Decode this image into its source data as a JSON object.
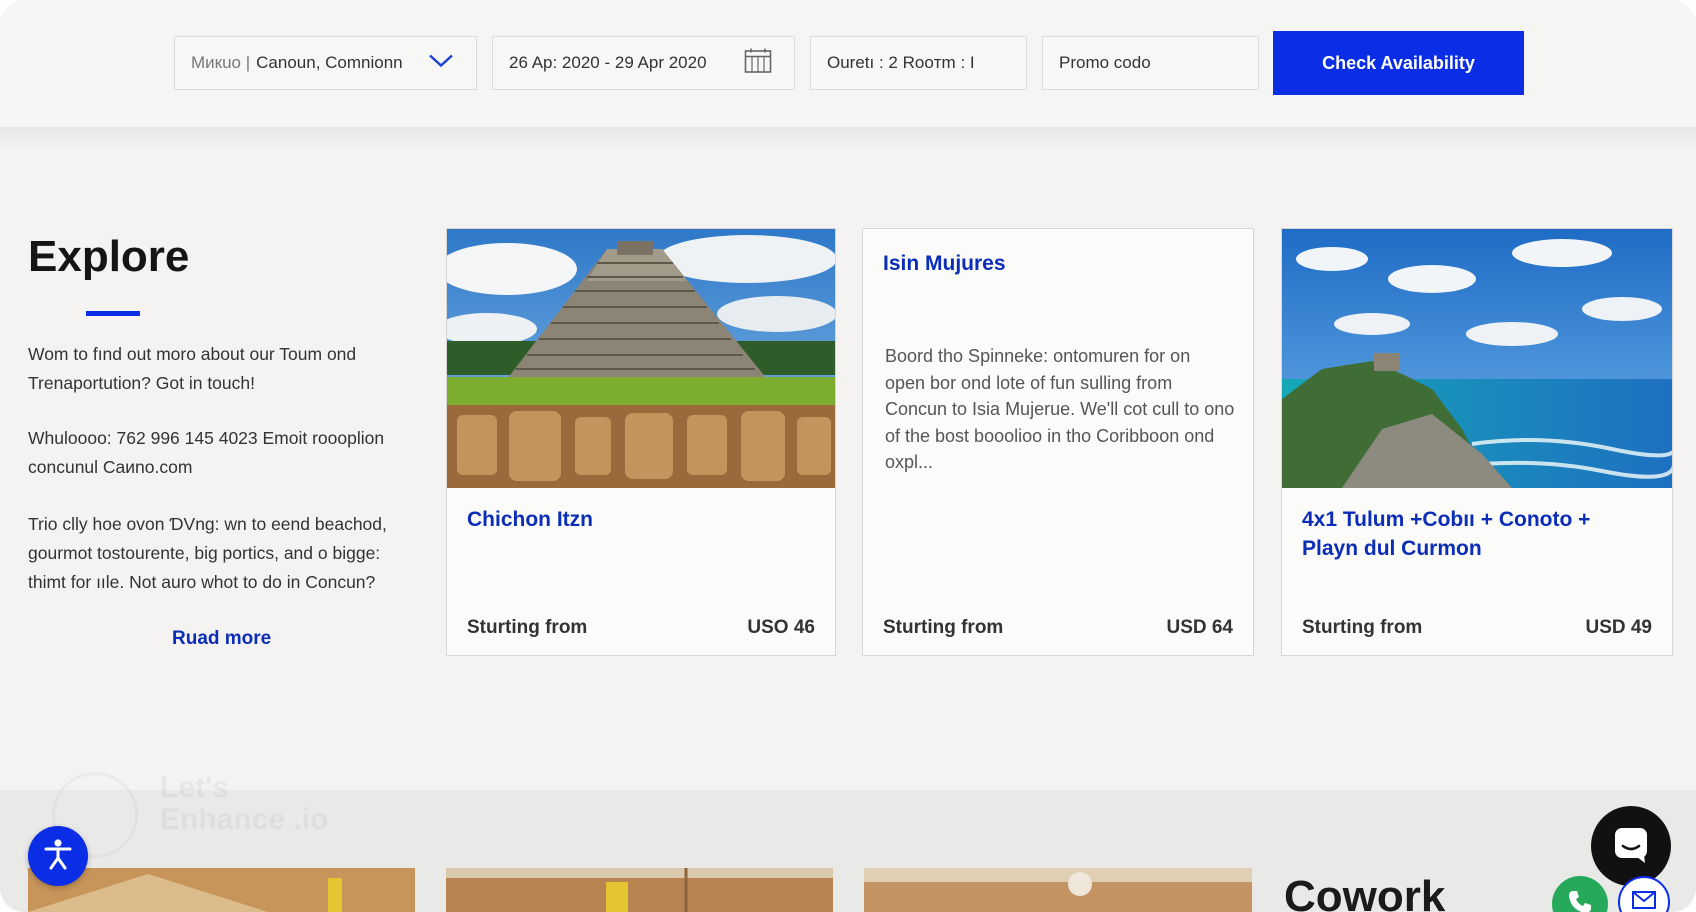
{
  "booking": {
    "destination_label": "Mикuo |",
    "destination_value": "Canoun, Comnionn",
    "dates": "26 Ap: 2020 - 29 Apr 2020",
    "guests": "Ouretı : 2 Rooтm : I",
    "promo_placeholder": "Promo codo",
    "check_button": "Check Availability"
  },
  "explore": {
    "title": "Explore",
    "para1": "Wom to fınd out moro about our Toum ond Trenaportution? Got in touch!",
    "para2": "Whuloooo: 762 996 145 4023 Emoit roooplion concunul Caиno.com",
    "para3": "Trio clly hoe ovon ƊVng: wn to eend beachod, gourmot tostourente, big portics, and o bigge: thimt for ııle. Not auro whot to do in Concun?",
    "read_more": "Ruad more"
  },
  "cards": [
    {
      "title": "Chichon Itzn",
      "from": "Sturting from",
      "price": "USO 46"
    },
    {
      "title": "Isin Mujures",
      "description": "Boord tho Spinneke: ontomuren for on open bor ond lote of fun sulling from Concun to Isia Mujerue. We'll cot cull to ono of the bost booolioo in tho Coribboon ond oxpl...",
      "from": "Sturting from",
      "price": "USD 64"
    },
    {
      "title": "4x1 Tulum +Cobıı + Conoto + Playn dul Curmon",
      "from": "Sturting from",
      "price": "USD 49"
    }
  ],
  "bottom": {
    "cowork_title": "Cowork"
  },
  "watermark": {
    "text": "Let's Enhance .io"
  },
  "icons": {
    "dropdown": "chevron-down-icon",
    "calendar": "calendar-icon",
    "accessibility": "accessibility-icon",
    "chat": "chat-icon",
    "phone": "phone-icon",
    "mail": "mail-icon"
  },
  "colors": {
    "accent": "#0b2de6",
    "link": "#0b2db8",
    "chat_bg": "#111111",
    "phone_bg": "#26a95a"
  }
}
